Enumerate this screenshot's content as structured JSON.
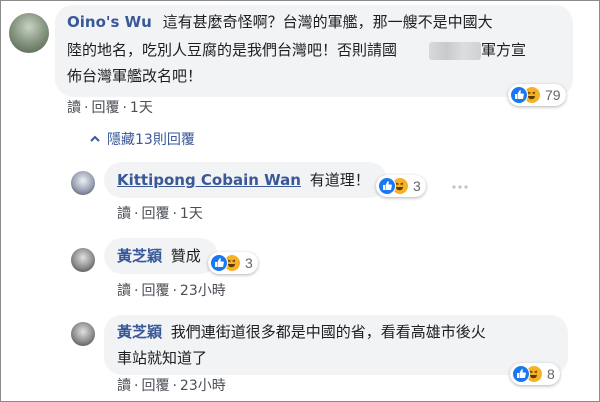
{
  "comments": [
    {
      "author": "Oino's Wu",
      "lines": [
        "這有甚麼奇怪啊？台灣的軍艦，那一艘不是中國大",
        "陸的地名，吃別人豆腐的是我們台灣吧！否則請國",
        "軍方宣",
        "佈台灣軍艦改名吧！"
      ],
      "reaction_count": "79",
      "actions": {
        "read": "讀",
        "reply": "回覆",
        "time": "1天"
      }
    },
    {
      "author": "Kittipong Cobain Wan",
      "text": "有道理！",
      "reaction_count": "3",
      "actions": {
        "read": "讀",
        "reply": "回覆",
        "time": "1天"
      }
    },
    {
      "author": "黃芝穎",
      "text": "贊成",
      "reaction_count": "3",
      "actions": {
        "read": "讀",
        "reply": "回覆",
        "time": "23小時"
      }
    },
    {
      "author": "黃芝穎",
      "lines": [
        "我們連街道很多都是中國的省，看看高雄市後火",
        "車站就知道了"
      ],
      "reaction_count": "8",
      "actions": {
        "read": "讀",
        "reply": "回覆",
        "time": "23小時"
      }
    }
  ],
  "hidden_replies_label": "隱藏13則回覆",
  "separator": "·",
  "more_icon": "ellipsis-icon",
  "colors": {
    "link": "#385898",
    "bubble": "#f2f3f5",
    "like": "#1877f2",
    "haha": "#f7b125"
  }
}
